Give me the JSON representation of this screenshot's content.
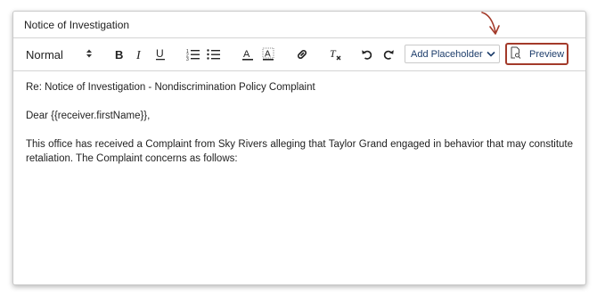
{
  "document": {
    "title": "Notice of Investigation"
  },
  "toolbar": {
    "format_select": {
      "value": "Normal"
    },
    "buttons": [
      {
        "name": "bold-button",
        "icon": "bold-icon"
      },
      {
        "name": "italic-button",
        "icon": "italic-icon"
      },
      {
        "name": "underline-button",
        "icon": "underline-icon"
      },
      {
        "name": "ordered-list-button",
        "icon": "ordered-list-icon"
      },
      {
        "name": "bullet-list-button",
        "icon": "bullet-list-icon"
      },
      {
        "name": "text-color-button",
        "icon": "text-color-icon"
      },
      {
        "name": "background-color-button",
        "icon": "highlight-icon"
      },
      {
        "name": "link-button",
        "icon": "link-icon"
      },
      {
        "name": "clear-format-button",
        "icon": "clear-format-icon"
      },
      {
        "name": "undo-button",
        "icon": "undo-icon"
      },
      {
        "name": "redo-button",
        "icon": "redo-icon"
      }
    ],
    "placeholder_select": {
      "label": "Add Placeholder"
    },
    "preview_button": {
      "label": "Preview",
      "icon": "document-search-icon"
    }
  },
  "body": {
    "subject_line": "Re: Notice of Investigation - Nondiscrimination Policy Complaint",
    "greeting": "Dear {{receiver.firstName}},",
    "paragraph": "This office has received a Complaint from Sky Rivers alleging that Taylor Grand engaged in behavior that may constitute retaliation. The Complaint concerns as follows:"
  },
  "colors": {
    "highlight_outline": "#a33a2a",
    "accent_text": "#1d3d6b"
  }
}
